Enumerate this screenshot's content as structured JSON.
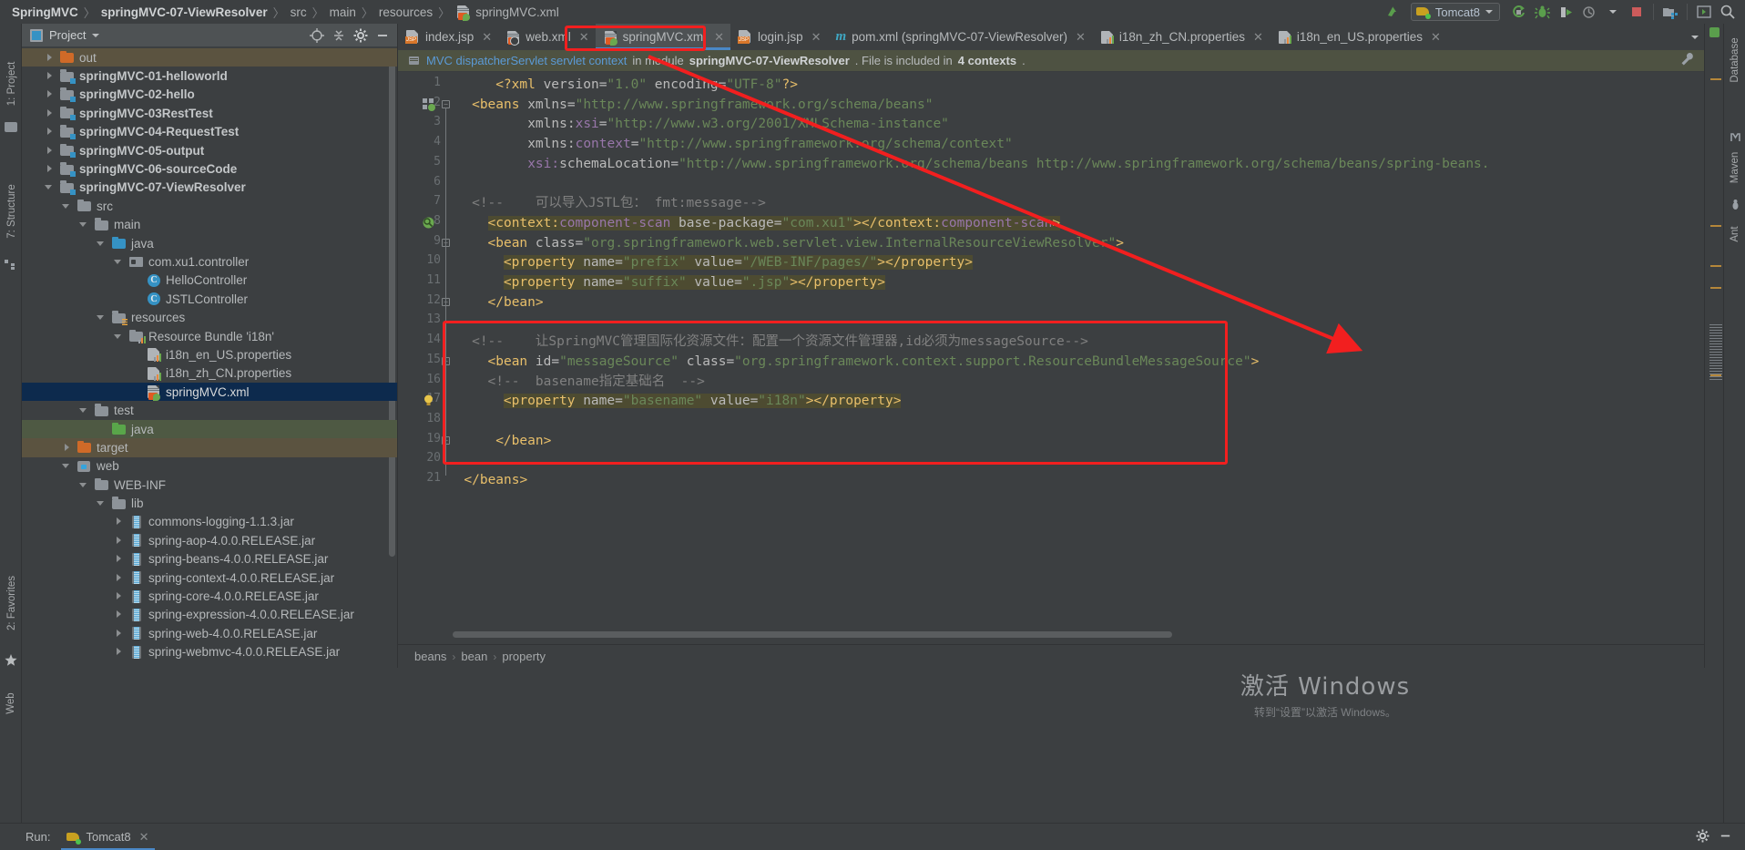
{
  "breadcrumb": {
    "items": [
      "SpringMVC",
      "springMVC-07-ViewResolver",
      "src",
      "main",
      "resources"
    ],
    "file": "springMVC.xml",
    "separator": "〉"
  },
  "toolbar": {
    "run_config": "Tomcat8",
    "icons": [
      "update-icon",
      "run-icon",
      "debug-icon",
      "debug-server-icon",
      "profile-icon",
      "stop-icon",
      "project-structure-icon",
      "open-window-icon",
      "search-everywhere-icon"
    ]
  },
  "project_panel": {
    "title": "Project",
    "header_icons": [
      "locate-icon",
      "collapse-all-icon",
      "settings-icon",
      "hide-icon"
    ],
    "tree": [
      {
        "label": "out",
        "depth": 1,
        "arrow": "closed",
        "icon": "folder-orange",
        "bold": false,
        "highlight": "brown"
      },
      {
        "label": "springMVC-01-helloworld",
        "depth": 1,
        "arrow": "closed",
        "icon": "module",
        "bold": true,
        "highlight": ""
      },
      {
        "label": "springMVC-02-hello",
        "depth": 1,
        "arrow": "closed",
        "icon": "module",
        "bold": true,
        "highlight": ""
      },
      {
        "label": "springMVC-03RestTest",
        "depth": 1,
        "arrow": "closed",
        "icon": "module",
        "bold": true,
        "highlight": ""
      },
      {
        "label": "springMVC-04-RequestTest",
        "depth": 1,
        "arrow": "closed",
        "icon": "module",
        "bold": true,
        "highlight": ""
      },
      {
        "label": "springMVC-05-output",
        "depth": 1,
        "arrow": "closed",
        "icon": "module",
        "bold": true,
        "highlight": ""
      },
      {
        "label": "springMVC-06-sourceCode",
        "depth": 1,
        "arrow": "closed",
        "icon": "module",
        "bold": true,
        "highlight": ""
      },
      {
        "label": "springMVC-07-ViewResolver",
        "depth": 1,
        "arrow": "open",
        "icon": "module",
        "bold": true,
        "highlight": ""
      },
      {
        "label": "src",
        "depth": 2,
        "arrow": "open",
        "icon": "folder-gray",
        "bold": false,
        "highlight": ""
      },
      {
        "label": "main",
        "depth": 3,
        "arrow": "open",
        "icon": "folder-gray",
        "bold": false,
        "highlight": ""
      },
      {
        "label": "java",
        "depth": 4,
        "arrow": "open",
        "icon": "folder-blue",
        "bold": false,
        "highlight": ""
      },
      {
        "label": "com.xu1.controller",
        "depth": 5,
        "arrow": "open",
        "icon": "package",
        "bold": false,
        "highlight": ""
      },
      {
        "label": "HelloController",
        "depth": 6,
        "arrow": "",
        "icon": "class",
        "bold": false,
        "highlight": ""
      },
      {
        "label": "JSTLController",
        "depth": 6,
        "arrow": "",
        "icon": "class",
        "bold": false,
        "highlight": ""
      },
      {
        "label": "resources",
        "depth": 4,
        "arrow": "open",
        "icon": "folder-resources",
        "bold": false,
        "highlight": ""
      },
      {
        "label": "Resource Bundle 'i18n'",
        "depth": 5,
        "arrow": "open",
        "icon": "folder-bundle",
        "bold": false,
        "highlight": ""
      },
      {
        "label": "i18n_en_US.properties",
        "depth": 6,
        "arrow": "",
        "icon": "properties",
        "bold": false,
        "highlight": ""
      },
      {
        "label": "i18n_zh_CN.properties",
        "depth": 6,
        "arrow": "",
        "icon": "properties",
        "bold": false,
        "highlight": ""
      },
      {
        "label": "springMVC.xml",
        "depth": 6,
        "arrow": "",
        "icon": "spring-xml",
        "bold": false,
        "highlight": "selected"
      },
      {
        "label": "test",
        "depth": 3,
        "arrow": "open",
        "icon": "folder-gray",
        "bold": false,
        "highlight": ""
      },
      {
        "label": "java",
        "depth": 4,
        "arrow": "",
        "icon": "folder-green",
        "bold": false,
        "highlight": "green"
      },
      {
        "label": "target",
        "depth": 2,
        "arrow": "closed",
        "icon": "folder-orange",
        "bold": false,
        "highlight": "brown"
      },
      {
        "label": "web",
        "depth": 2,
        "arrow": "open",
        "icon": "web-folder",
        "bold": false,
        "highlight": ""
      },
      {
        "label": "WEB-INF",
        "depth": 3,
        "arrow": "open",
        "icon": "folder-gray",
        "bold": false,
        "highlight": ""
      },
      {
        "label": "lib",
        "depth": 4,
        "arrow": "open",
        "icon": "folder-gray",
        "bold": false,
        "highlight": ""
      },
      {
        "label": "commons-logging-1.1.3.jar",
        "depth": 5,
        "arrow": "closed",
        "icon": "jar",
        "bold": false,
        "highlight": ""
      },
      {
        "label": "spring-aop-4.0.0.RELEASE.jar",
        "depth": 5,
        "arrow": "closed",
        "icon": "jar",
        "bold": false,
        "highlight": ""
      },
      {
        "label": "spring-beans-4.0.0.RELEASE.jar",
        "depth": 5,
        "arrow": "closed",
        "icon": "jar",
        "bold": false,
        "highlight": ""
      },
      {
        "label": "spring-context-4.0.0.RELEASE.jar",
        "depth": 5,
        "arrow": "closed",
        "icon": "jar",
        "bold": false,
        "highlight": ""
      },
      {
        "label": "spring-core-4.0.0.RELEASE.jar",
        "depth": 5,
        "arrow": "closed",
        "icon": "jar",
        "bold": false,
        "highlight": ""
      },
      {
        "label": "spring-expression-4.0.0.RELEASE.jar",
        "depth": 5,
        "arrow": "closed",
        "icon": "jar",
        "bold": false,
        "highlight": ""
      },
      {
        "label": "spring-web-4.0.0.RELEASE.jar",
        "depth": 5,
        "arrow": "closed",
        "icon": "jar",
        "bold": false,
        "highlight": ""
      },
      {
        "label": "spring-webmvc-4.0.0.RELEASE.jar",
        "depth": 5,
        "arrow": "closed",
        "icon": "jar",
        "bold": false,
        "highlight": ""
      }
    ]
  },
  "left_tool_strips": [
    "1: Project",
    "7: Structure",
    "2: Favorites",
    "Web"
  ],
  "right_tool_strips": [
    "Database",
    "Maven",
    "Ant"
  ],
  "editor_tabs": [
    {
      "label": "index.jsp",
      "icon": "jsp-file-icon",
      "active": false,
      "highlighted": false
    },
    {
      "label": "web.xml",
      "icon": "xml-file-icon",
      "active": false,
      "highlighted": false
    },
    {
      "label": "springMVC.xml",
      "icon": "spring-xml-icon",
      "active": true,
      "highlighted": true
    },
    {
      "label": "login.jsp",
      "icon": "jsp-file-icon",
      "active": false,
      "highlighted": false
    },
    {
      "label": "pom.xml (springMVC-07-ViewResolver)",
      "icon": "maven-file-icon",
      "active": false,
      "highlighted": false
    },
    {
      "label": "i18n_zh_CN.properties",
      "icon": "properties-file-icon",
      "active": false,
      "highlighted": false
    },
    {
      "label": "i18n_en_US.properties",
      "icon": "properties-file-icon",
      "active": false,
      "highlighted": false
    }
  ],
  "notice": {
    "link_text": "MVC dispatcherServlet servlet context",
    "text_middle": "in module ",
    "module": "springMVC-07-ViewResolver",
    "text_tail": ". File is included in ",
    "contexts": "4 contexts",
    "period": ".",
    "wrench_icon": "configure-icon"
  },
  "code": {
    "lines": [
      {
        "n": 1,
        "indent": 0,
        "segs": [
          {
            "t": "<?",
            "c": "t-pi"
          },
          {
            "t": "xml ",
            "c": "t-pi"
          },
          {
            "t": "version",
            "c": "t-attr"
          },
          {
            "t": "=",
            "c": "t-attr"
          },
          {
            "t": "\"1.0\"",
            "c": "t-str"
          },
          {
            "t": " encoding",
            "c": "t-attr"
          },
          {
            "t": "=",
            "c": "t-attr"
          },
          {
            "t": "\"UTF-8\"",
            "c": "t-str"
          },
          {
            "t": "?>",
            "c": "t-pi"
          }
        ]
      },
      {
        "n": 2,
        "indent": 0,
        "segs": [
          {
            "t": "<beans ",
            "c": "t-tag"
          },
          {
            "t": "xmlns",
            "c": "t-attr"
          },
          {
            "t": "=",
            "c": "t-attr"
          },
          {
            "t": "\"http://www.springframework.org/schema/beans\"",
            "c": "t-str"
          }
        ]
      },
      {
        "n": 3,
        "indent": 0,
        "segs": [
          {
            "t": "       xmlns:",
            "c": "t-attr"
          },
          {
            "t": "xsi",
            "c": "t-ns"
          },
          {
            "t": "=",
            "c": "t-attr"
          },
          {
            "t": "\"http://www.w3.org/2001/XMLSchema-instance\"",
            "c": "t-str"
          }
        ]
      },
      {
        "n": 4,
        "indent": 0,
        "segs": [
          {
            "t": "       xmlns:",
            "c": "t-attr"
          },
          {
            "t": "context",
            "c": "t-ns"
          },
          {
            "t": "=",
            "c": "t-attr"
          },
          {
            "t": "\"http://www.springframework.org/schema/context\"",
            "c": "t-str"
          }
        ]
      },
      {
        "n": 5,
        "indent": 0,
        "segs": [
          {
            "t": "       xsi:",
            "c": "t-ns"
          },
          {
            "t": "schemaLocation",
            "c": "t-attr"
          },
          {
            "t": "=",
            "c": "t-attr"
          },
          {
            "t": "\"http://www.springframework.org/schema/beans http://www.springframework.org/schema/beans/spring-beans.",
            "c": "t-str"
          }
        ]
      },
      {
        "n": 6,
        "indent": 0,
        "segs": []
      },
      {
        "n": 7,
        "indent": 0,
        "segs": [
          {
            "t": "<!--    可以导入JSTL包： fmt:message-->",
            "c": "t-com"
          }
        ]
      },
      {
        "n": 8,
        "indent": 0,
        "segs": [
          {
            "t": "<context:",
            "c": "t-tag hl-yellow"
          },
          {
            "t": "component-scan",
            "c": "t-ns hl-yellow"
          },
          {
            "t": " base-package",
            "c": "t-attr hl-yellow"
          },
          {
            "t": "=",
            "c": "t-attr hl-yellow"
          },
          {
            "t": "\"com.xu1\"",
            "c": "t-str hl-yellow"
          },
          {
            "t": "></context:",
            "c": "t-tag hl-yellow"
          },
          {
            "t": "component-scan",
            "c": "t-ns hl-yellow"
          },
          {
            "t": ">",
            "c": "t-tag hl-yellow"
          }
        ]
      },
      {
        "n": 9,
        "indent": 0,
        "segs": [
          {
            "t": "<bean ",
            "c": "t-tag"
          },
          {
            "t": "class",
            "c": "t-attr"
          },
          {
            "t": "=",
            "c": "t-attr"
          },
          {
            "t": "\"org.springframework.web.servlet.view.InternalResourceViewResolver\"",
            "c": "t-str"
          },
          {
            "t": ">",
            "c": "t-tag"
          }
        ]
      },
      {
        "n": 10,
        "indent": 0,
        "segs": [
          {
            "t": "<property ",
            "c": "t-tag hl-yellow"
          },
          {
            "t": "name",
            "c": "t-attr hl-yellow"
          },
          {
            "t": "=",
            "c": "t-attr hl-yellow"
          },
          {
            "t": "\"prefix\"",
            "c": "t-str hl-yellow"
          },
          {
            "t": " value",
            "c": "t-attr hl-yellow"
          },
          {
            "t": "=",
            "c": "t-attr hl-yellow"
          },
          {
            "t": "\"/WEB-INF/pages/\"",
            "c": "t-str hl-yellow"
          },
          {
            "t": "></property>",
            "c": "t-tag hl-yellow"
          }
        ]
      },
      {
        "n": 11,
        "indent": 0,
        "segs": [
          {
            "t": "<property ",
            "c": "t-tag hl-yellow"
          },
          {
            "t": "name",
            "c": "t-attr hl-yellow"
          },
          {
            "t": "=",
            "c": "t-attr hl-yellow"
          },
          {
            "t": "\"suffix\"",
            "c": "t-str hl-yellow"
          },
          {
            "t": " value",
            "c": "t-attr hl-yellow"
          },
          {
            "t": "=",
            "c": "t-attr hl-yellow"
          },
          {
            "t": "\".jsp\"",
            "c": "t-str hl-yellow"
          },
          {
            "t": "></property>",
            "c": "t-tag hl-yellow"
          }
        ]
      },
      {
        "n": 12,
        "indent": 0,
        "segs": [
          {
            "t": "</bean>",
            "c": "t-tag"
          }
        ]
      },
      {
        "n": 13,
        "indent": 0,
        "segs": []
      },
      {
        "n": 14,
        "indent": 0,
        "segs": [
          {
            "t": "<!--    让SpringMVC管理国际化资源文件：配置一个资源文件管理器,id必须为messageSource-->",
            "c": "t-com"
          }
        ]
      },
      {
        "n": 15,
        "indent": 0,
        "segs": [
          {
            "t": "<bean ",
            "c": "t-tag"
          },
          {
            "t": "id",
            "c": "t-attr"
          },
          {
            "t": "=",
            "c": "t-attr"
          },
          {
            "t": "\"messageSource\"",
            "c": "t-str"
          },
          {
            "t": " class",
            "c": "t-attr"
          },
          {
            "t": "=",
            "c": "t-attr"
          },
          {
            "t": "\"org.springframework.context.support.ResourceBundleMessageSource\"",
            "c": "t-str"
          },
          {
            "t": ">",
            "c": "t-tag"
          }
        ]
      },
      {
        "n": 16,
        "indent": 0,
        "segs": [
          {
            "t": "<!--  basename指定基础名  -->",
            "c": "t-com"
          }
        ]
      },
      {
        "n": 17,
        "indent": 0,
        "segs": [
          {
            "t": "<property ",
            "c": "t-tag hl-yellow"
          },
          {
            "t": "name",
            "c": "t-attr hl-yellow"
          },
          {
            "t": "=",
            "c": "t-attr hl-yellow"
          },
          {
            "t": "\"basename\"",
            "c": "t-str hl-yellow"
          },
          {
            "t": " value",
            "c": "t-attr hl-yellow"
          },
          {
            "t": "=",
            "c": "t-attr hl-yellow"
          },
          {
            "t": "\"i18n\"",
            "c": "t-str hl-yellow"
          },
          {
            "t": "></property>",
            "c": "t-tag hl-yellow"
          }
        ]
      },
      {
        "n": 18,
        "indent": 0,
        "segs": []
      },
      {
        "n": 19,
        "indent": 0,
        "segs": [
          {
            "t": "</bean>",
            "c": "t-tag"
          }
        ]
      },
      {
        "n": 20,
        "indent": 0,
        "segs": []
      },
      {
        "n": 21,
        "indent": 0,
        "segs": [
          {
            "t": "</beans>",
            "c": "t-tag"
          }
        ]
      }
    ]
  },
  "status_breadcrumb": [
    "beans",
    "bean",
    "property"
  ],
  "run_panel": {
    "label": "Run:",
    "tab": "Tomcat8",
    "icons": [
      "settings-icon",
      "minimize-icon"
    ]
  },
  "watermark": {
    "line1": "激活 Windows",
    "line2": "转到“设置”以激活 Windows。"
  },
  "colors": {
    "accent_blue": "#4a88c7",
    "annotation_red": "#f21f1f",
    "selection_blue": "#0d2a4d",
    "highlight_yellow": "#4d4b31",
    "notice_bg": "#4e5242"
  }
}
